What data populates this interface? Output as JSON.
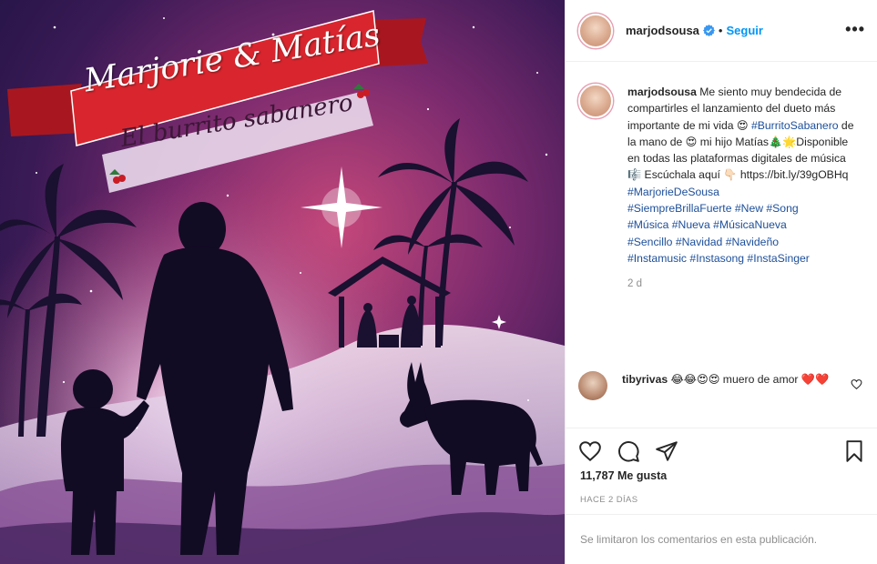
{
  "post_image": {
    "title_line1": "Marjorie & Matías",
    "title_line2": "El burrito sabanero"
  },
  "header": {
    "username": "marjodsousa",
    "separator": "•",
    "follow_label": "Seguir",
    "more_label": "•••",
    "verified_icon": "verified-badge-icon"
  },
  "caption": {
    "username": "marjodsousa",
    "text_1": " Me siento muy bendecida de compartirles el lanzamiento del dueto más importante de mi vida 😍",
    "tag_burrito": "#BurritoSabanero",
    "text_2": " de la mano de 😍 mi hijo Matías🎄🌟Disponible en todas las plataformas digitales de música 🎼 Escúchala aquí 👇🏻 https://bit.ly/39gOBHq",
    "hashtags_1": "#MarjorieDeSousa",
    "hashtags_2": "#SiempreBrillaFuerte #New #Song",
    "hashtags_3": "#Música #Nueva #MúsicaNueva",
    "hashtags_4": "#Sencillo #Navidad #Navideño",
    "hashtags_5": "#Instamusic #Instasong #InstaSinger",
    "time": "2 d"
  },
  "comment": {
    "username": "tibyrivas",
    "text": " 😂😂😍😍 muero de amor ❤️❤️"
  },
  "actions": {
    "like_icon": "heart-icon",
    "comment_icon": "comment-icon",
    "share_icon": "send-icon",
    "save_icon": "bookmark-icon"
  },
  "likes_text": "11,787 Me gusta",
  "date_text": "HACE 2 DÍAS",
  "comments_limited_text": "Se limitaron los comentarios en esta publicación.",
  "colors": {
    "accent_blue": "#0095f6",
    "hashtag_blue": "#1d4f9a",
    "muted_gray": "#8e8e8e",
    "ribbon_red": "#d9262e"
  }
}
